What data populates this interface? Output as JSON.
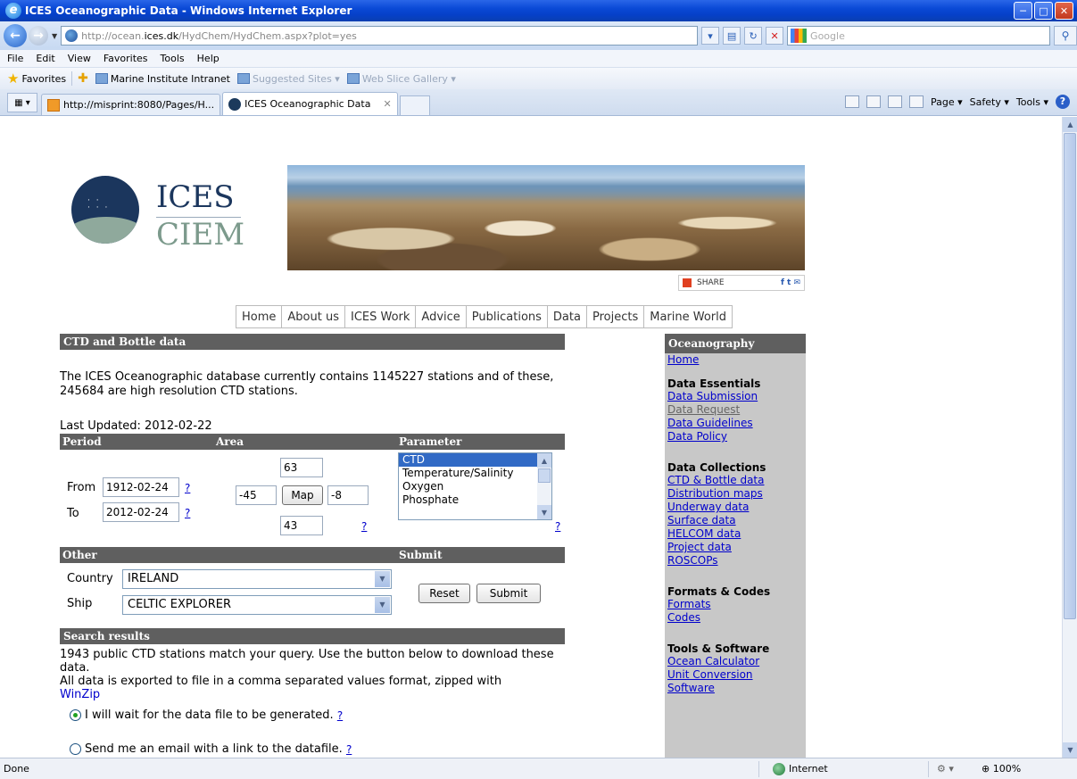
{
  "window": {
    "title": "ICES Oceanographic Data - Windows Internet Explorer",
    "icon": "ie-icon",
    "buttons": [
      "minimize",
      "maximize",
      "close"
    ]
  },
  "address_bar": {
    "url_prefix": "http://ocean.",
    "url_domain": "ices.dk",
    "url_rest": "/HydChem/HydChem.aspx?plot=yes",
    "search_placeholder": "Google"
  },
  "menu": [
    "File",
    "Edit",
    "View",
    "Favorites",
    "Tools",
    "Help"
  ],
  "favorites_bar": {
    "label": "Favorites",
    "items": [
      {
        "label": "Marine Institute Intranet",
        "dim": false
      },
      {
        "label": "Suggested Sites ▾",
        "dim": true
      },
      {
        "label": "Web Slice Gallery ▾",
        "dim": true
      }
    ]
  },
  "tabs": [
    {
      "label": "http://misprint:8080/Pages/H...",
      "active": false
    },
    {
      "label": "ICES Oceanographic Data",
      "active": true
    }
  ],
  "command_bar": [
    "Page ▾",
    "Safety ▾",
    "Tools ▾"
  ],
  "logo": {
    "line1": "ICES",
    "line2": "CIEM"
  },
  "share": {
    "label": "SHARE"
  },
  "top_nav": [
    "Home",
    "About us",
    "ICES Work",
    "Advice",
    "Publications",
    "Data",
    "Projects",
    "Marine World"
  ],
  "ctd": {
    "section_title": "CTD and Bottle data",
    "intro": "The ICES Oceanographic database currently contains 1145227 stations and of these, 245684 are high resolution CTD stations.",
    "last_updated": "Last Updated: 2012-02-22"
  },
  "form": {
    "headers": {
      "period": "Period",
      "area": "Area",
      "parameter": "Parameter",
      "other": "Other",
      "submit": "Submit"
    },
    "from_label": "From",
    "to_label": "To",
    "from_value": "1912-02-24",
    "to_value": "2012-02-24",
    "help": "?",
    "area": {
      "north": "63",
      "west": "-45",
      "east": "-8",
      "south": "43",
      "map_button": "Map"
    },
    "parameters": [
      "CTD",
      "Temperature/Salinity",
      "Oxygen",
      "Phosphate"
    ],
    "selected_parameter": "CTD",
    "country_label": "Country",
    "country_value": "IRELAND",
    "ship_label": "Ship",
    "ship_value": "CELTIC EXPLORER",
    "reset_button": "Reset",
    "submit_button": "Submit"
  },
  "results": {
    "section_title": "Search results",
    "match_text": "1943 public CTD stations match your query. Use the button below to download these data.",
    "export_text": "All data is exported to file in a comma separated values format, zipped with",
    "winzip_link": "WinZip",
    "option_wait": "I will wait for the data file to be generated.",
    "option_email": "Send me an email with a link to the datafile."
  },
  "sidebar": {
    "title": "Oceanography",
    "home": "Home",
    "groups": [
      {
        "title": "Data Essentials",
        "links": [
          {
            "label": "Data Submission",
            "dim": false
          },
          {
            "label": "Data Request",
            "dim": true
          },
          {
            "label": "Data Guidelines",
            "dim": false
          },
          {
            "label": "Data Policy",
            "dim": false
          }
        ]
      },
      {
        "title": "Data Collections",
        "links": [
          {
            "label": "CTD & Bottle data",
            "dim": false
          },
          {
            "label": "Distribution maps",
            "dim": false
          },
          {
            "label": "Underway data",
            "dim": false
          },
          {
            "label": "Surface data",
            "dim": false
          },
          {
            "label": "HELCOM data",
            "dim": false
          },
          {
            "label": "Project data",
            "dim": false
          },
          {
            "label": "ROSCOPs",
            "dim": false
          }
        ]
      },
      {
        "title": "Formats & Codes",
        "links": [
          {
            "label": "Formats",
            "dim": false
          },
          {
            "label": "Codes",
            "dim": false
          }
        ]
      },
      {
        "title": "Tools & Software",
        "links": [
          {
            "label": "Ocean Calculator",
            "dim": false
          },
          {
            "label": "Unit Conversion",
            "dim": false
          },
          {
            "label": "Software",
            "dim": false
          }
        ]
      }
    ]
  },
  "status": {
    "left": "Done",
    "zone": "Internet",
    "zoom": "⊕ 100%"
  }
}
